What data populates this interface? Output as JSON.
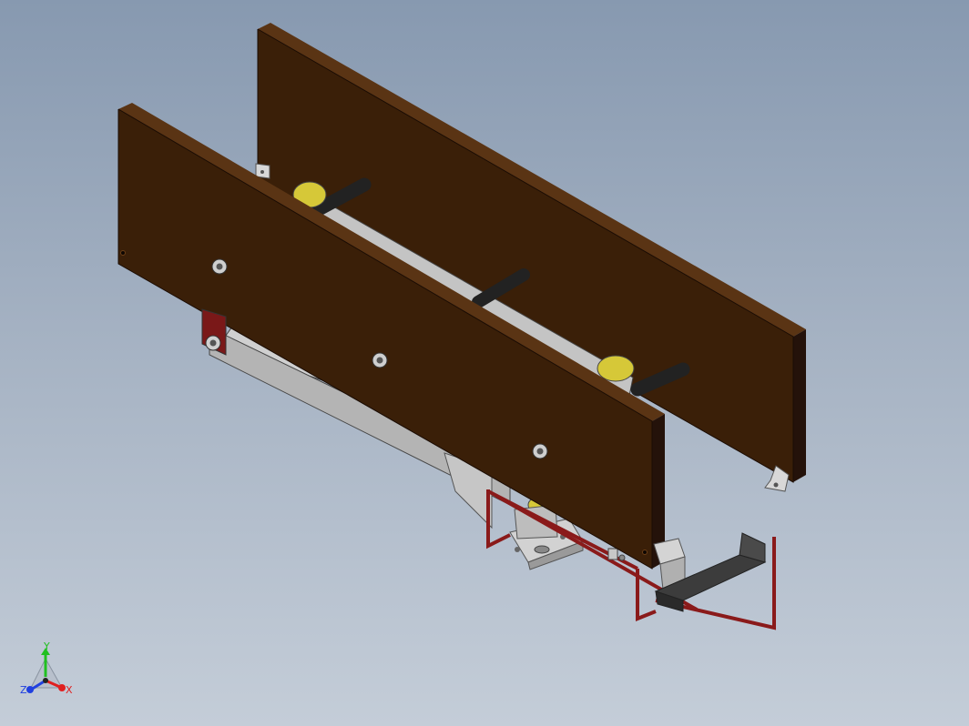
{
  "view": {
    "background_top": "#8799b0",
    "background_bottom": "#c4cdd8"
  },
  "model": {
    "panel_color": "#3a1f08",
    "panel_edge_color": "#5a3414",
    "roller_color": "#c8c8c8",
    "shaft_color": "#2a2a2a",
    "bearing_color": "#d4c830",
    "frame_color": "#8a1a1a",
    "bracket_color": "#b8b8b8"
  },
  "triad": {
    "y_label": "Y",
    "z_label": "Z",
    "x_label": "X",
    "y_color": "#20c020",
    "z_color": "#2040e0",
    "x_color": "#e02020"
  }
}
